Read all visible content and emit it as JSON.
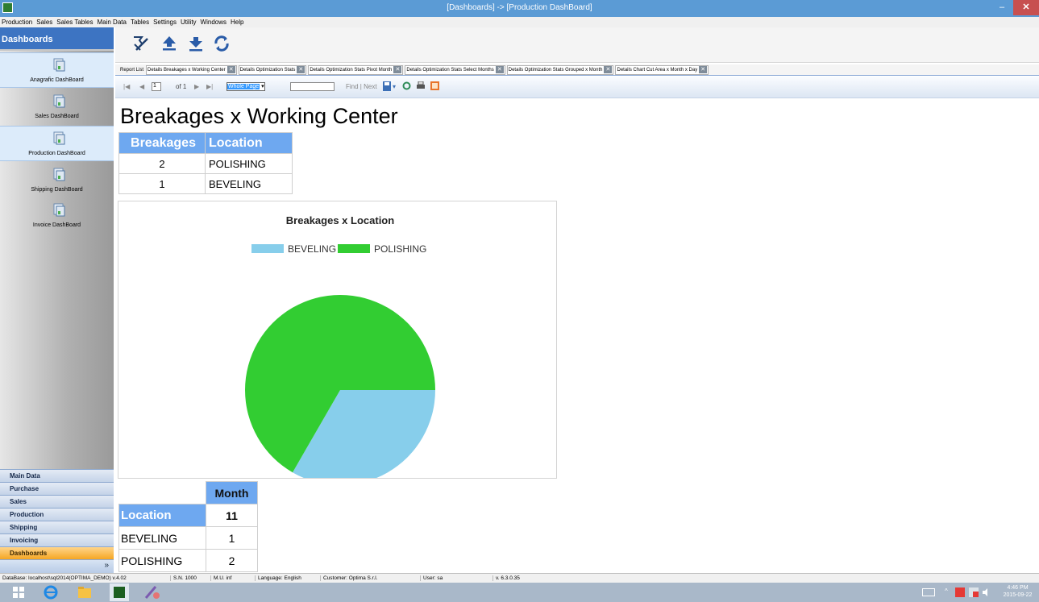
{
  "window": {
    "title": "[Dashboards] -> [Production DashBoard]",
    "minimize_glyph": "–",
    "close_glyph": "✕"
  },
  "menu": [
    "Production",
    "Sales",
    "Sales Tables",
    "Main Data",
    "Tables",
    "Settings",
    "Utility",
    "Windows",
    "Help"
  ],
  "sidebar": {
    "header": "Dashboards",
    "dashboards": [
      {
        "label": "Anagrafic DashBoard",
        "selected": true
      },
      {
        "label": "Sales DashBoard",
        "selected": false
      },
      {
        "label": "Production DashBoard",
        "selected": true
      },
      {
        "label": "Shipping DashBoard",
        "selected": false
      },
      {
        "label": "Invoice DashBoard",
        "selected": false
      }
    ],
    "grip": "..........",
    "nav_buttons": [
      {
        "label": "Main Data",
        "active": false
      },
      {
        "label": "Purchase",
        "active": false
      },
      {
        "label": "Sales",
        "active": false
      },
      {
        "label": "Production",
        "active": false
      },
      {
        "label": "Shipping",
        "active": false
      },
      {
        "label": "Invoicing",
        "active": false
      },
      {
        "label": "Dashboards",
        "active": true
      }
    ],
    "footer_chevron": "»"
  },
  "toolbar": {
    "icons": [
      "export-icon",
      "upload-icon",
      "download-icon",
      "refresh-icon"
    ]
  },
  "tabs": {
    "first": "Report List",
    "items": [
      "Details Breakages x Working Center",
      "Details Optimization Stats",
      "Details Optimization Stats Pivot Month",
      "Details Optimization Stats Select Months",
      "Details Optimization Stats Grouped x Month",
      "Details Chart Cut Area x Month x Day"
    ],
    "close_glyph": "✕"
  },
  "report_nav": {
    "first": "|◀",
    "prev": "◀",
    "page": "1",
    "of_label": "of 1",
    "next": "▶",
    "last": "▶|",
    "zoom": "Whole Page",
    "find_label": "Find | Next"
  },
  "report": {
    "title": "Breakages x Working Center",
    "table1": {
      "headers": [
        "Breakages",
        "Location"
      ],
      "rows": [
        [
          "2",
          "POLISHING"
        ],
        [
          "1",
          "BEVELING"
        ]
      ]
    },
    "pivot": {
      "month_header": "Month",
      "location_header": "Location",
      "month_value": "11",
      "rows": [
        [
          "BEVELING",
          "1"
        ],
        [
          "POLISHING",
          "2"
        ]
      ]
    }
  },
  "chart_data": {
    "type": "pie",
    "title": "Breakages x Location",
    "categories": [
      "BEVELING",
      "POLISHING"
    ],
    "values": [
      1,
      2
    ],
    "colors": [
      "#87ceeb",
      "#32cd32"
    ],
    "legend": "top",
    "start_angle_deg": 90
  },
  "statusbar": {
    "database": "DataBase: localhost\\sql2014(OPTIMA_DEMO) v.4.02",
    "serial": "S.N. 1000",
    "mu": "M.U. inf",
    "language": "Language: English",
    "customer": "Customer: Optima S.r.l.",
    "user": "User: sa",
    "version": "v. 6.3.0.35"
  },
  "taskbar": {
    "time": "4:46 PM",
    "date": "2015-09-22",
    "icons": [
      "start-icon",
      "internet-explorer-icon",
      "file-explorer-icon",
      "optima-app-icon",
      "paint-icon"
    ]
  }
}
